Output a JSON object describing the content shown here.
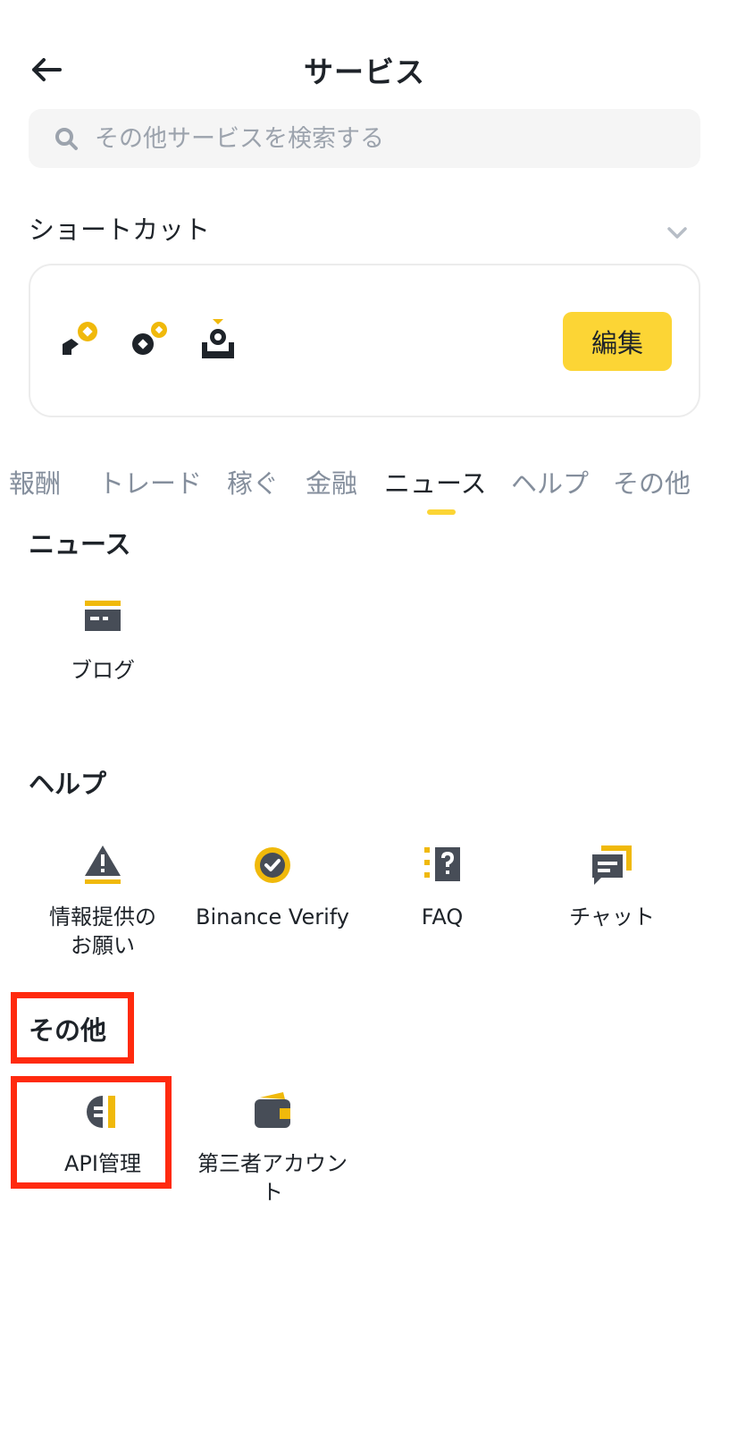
{
  "header": {
    "title": "サービス"
  },
  "search": {
    "placeholder": "その他サービスを検索する",
    "value": ""
  },
  "shortcuts": {
    "heading": "ショートカット",
    "icons": [
      "coin-withdraw-icon",
      "coins-icon",
      "deposit-icon"
    ],
    "edit_label": "編集"
  },
  "tabs": [
    {
      "label": "報酬"
    },
    {
      "label": "トレード"
    },
    {
      "label": "稼ぐ"
    },
    {
      "label": "金融"
    },
    {
      "label": "ニュース",
      "active": true
    },
    {
      "label": "ヘルプ"
    },
    {
      "label": "その他"
    }
  ],
  "sections": {
    "news": {
      "title": "ニュース",
      "items": [
        {
          "label": "ブログ",
          "icon": "blog-icon"
        }
      ]
    },
    "help": {
      "title": "ヘルプ",
      "items": [
        {
          "label": "情報提供のお願い",
          "icon": "warning-icon"
        },
        {
          "label": "Binance Verify",
          "icon": "verify-badge-icon"
        },
        {
          "label": "FAQ",
          "icon": "faq-icon"
        },
        {
          "label": "チャット",
          "icon": "chat-icon"
        }
      ]
    },
    "other": {
      "title": "その他",
      "items": [
        {
          "label": "API管理",
          "icon": "api-plug-icon"
        },
        {
          "label": "第三者アカウント",
          "icon": "wallet-icon"
        }
      ]
    }
  },
  "colors": {
    "accent": "#fcd535",
    "text": "#1e2329",
    "muted": "#848e9c",
    "highlight": "#ff2a0e"
  }
}
